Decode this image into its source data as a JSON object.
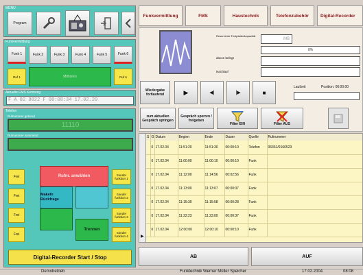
{
  "menu": {
    "title": "MENU",
    "program_label": "Program"
  },
  "funk": {
    "title": "Funkvermittlung",
    "buttons": [
      "Funk 1",
      "Funk 2",
      "Funk 3",
      "Funk 4",
      "Funk 5",
      "Funk 6"
    ],
    "ruf1": "Ruf 1",
    "main_label": "Mithören",
    "ruf6": "Ruf 6"
  },
  "fms": {
    "title": "Aktuelle FMS Kennung",
    "value": "F A 82 8822 F  08:08:34  17.02.20"
  },
  "telefon": {
    "title": "Telefon",
    "incoming_label": "Rufnummer gehend",
    "incoming_value": "11110",
    "outgoing_label": "Rufnummer kommend",
    "outgoing_value": ""
  },
  "dial": {
    "frei": "Frei",
    "ruf_anwaehlen": "Rufnr. anwählen",
    "sonder1": "Sonder funktion 1",
    "sonder2": "Sonder funktion 2",
    "sonder3": "Sonder funktion 3",
    "sonder4": "Sonder funktion 4",
    "makeln": "Makeln Rückfrage",
    "trennen": "Trennen"
  },
  "recorder_button": "Digital-Recorder Start / Stop",
  "tabs": [
    "Funkvermittlung",
    "FMS",
    "Haustechnik",
    "Telefonzubehör",
    "Digital-Recorder"
  ],
  "recorder": {
    "reserved_label": "Reservierte Festplattenkapazität",
    "reserved_value": "MB",
    "percent": "0%",
    "used_label": "davon belegt",
    "nachlauf_label": "Nachlauf",
    "wiedergabe": "Wiedergabe fortlaufend",
    "laufzeit": "Laufzeit",
    "position": "Position: 00:00:00"
  },
  "actions": {
    "jump": "zum aktuellen Gespräch springen",
    "lock": "Gespräch sperren / freigeben",
    "filter_on": "Filter EIN",
    "filter_off": "Filter AUS"
  },
  "table": {
    "headers": [
      "S",
      "G",
      "Datum",
      "Beginn",
      "Ende",
      "Dauer",
      "Quelle",
      "Rufnummer"
    ],
    "rows": [
      [
        "",
        "0",
        "17.02.04",
        "11:51:20",
        "11:51:30",
        "00:00:10",
        "Telefon",
        "06361/9166523"
      ],
      [
        "",
        "0",
        "17.02.04",
        "11:00:00",
        "11:00:10",
        "00:00:10",
        "Funk",
        ""
      ],
      [
        "",
        "0",
        "17.02.04",
        "11:12:00",
        "11:14:56",
        "00:02:56",
        "Funk",
        ""
      ],
      [
        "",
        "0",
        "17.02.04",
        "11:13:00",
        "11:13:07",
        "00:00:07",
        "Funk",
        ""
      ],
      [
        "",
        "0",
        "17.02.04",
        "11:15:30",
        "11:15:58",
        "00:00:28",
        "Funk",
        ""
      ],
      [
        "",
        "0",
        "17.02.04",
        "11:22:23",
        "11:23:00",
        "00:00:37",
        "Funk",
        ""
      ],
      [
        "",
        "0",
        "17.02.04",
        "12:00:00",
        "12:00:10",
        "00:00:10",
        "Funk",
        ""
      ]
    ]
  },
  "bottom": {
    "ab": "AB",
    "auf": "AUF"
  },
  "status": {
    "mode": "Demobetrieb",
    "company": "Funktechnik Werner Müller Speicher",
    "date": "17.02.2004",
    "time": "08:08"
  }
}
